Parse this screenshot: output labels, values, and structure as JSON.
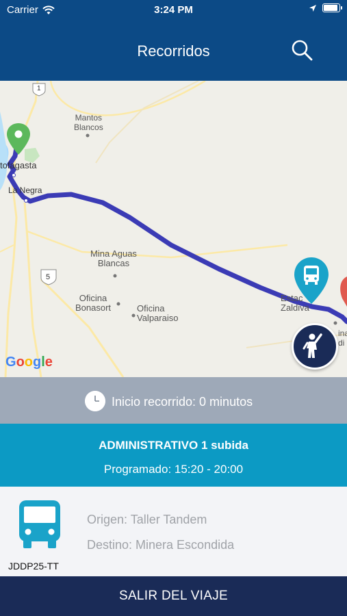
{
  "status": {
    "carrier": "Carrier",
    "time": "3:24 PM"
  },
  "header": {
    "title": "Recorridos"
  },
  "map": {
    "labels": {
      "mantos": "Mantos\nBlancos",
      "antofagasta": "tofagasta",
      "lanegra": "La Negra",
      "minaaguas": "Mina Aguas\nBlancas",
      "bonasort": "Oficina\nBonasort",
      "valparaiso": "Oficina\nValparaiso",
      "estacion": "Estac\nZaldiva",
      "mina": "ina\ndi",
      "route1": "1",
      "route5": "5"
    },
    "attribution": [
      "G",
      "o",
      "o",
      "g",
      "l",
      "e"
    ],
    "route_color": "#3b3bb5",
    "origin_marker_color": "#5cb85c",
    "bus_marker_color": "#1aa3c9"
  },
  "trip": {
    "start_text": "Inicio recorrido: 0 minutos",
    "route_name": "ADMINISTRATIVO 1 subida",
    "schedule": "Programado: 15:20 - 20:00",
    "origin": "Origen: Taller Tandem",
    "destination": "Destino: Minera Escondida",
    "plate": "JDDP25-TT"
  },
  "footer": {
    "exit_label": "SALIR DEL VIAJE"
  }
}
